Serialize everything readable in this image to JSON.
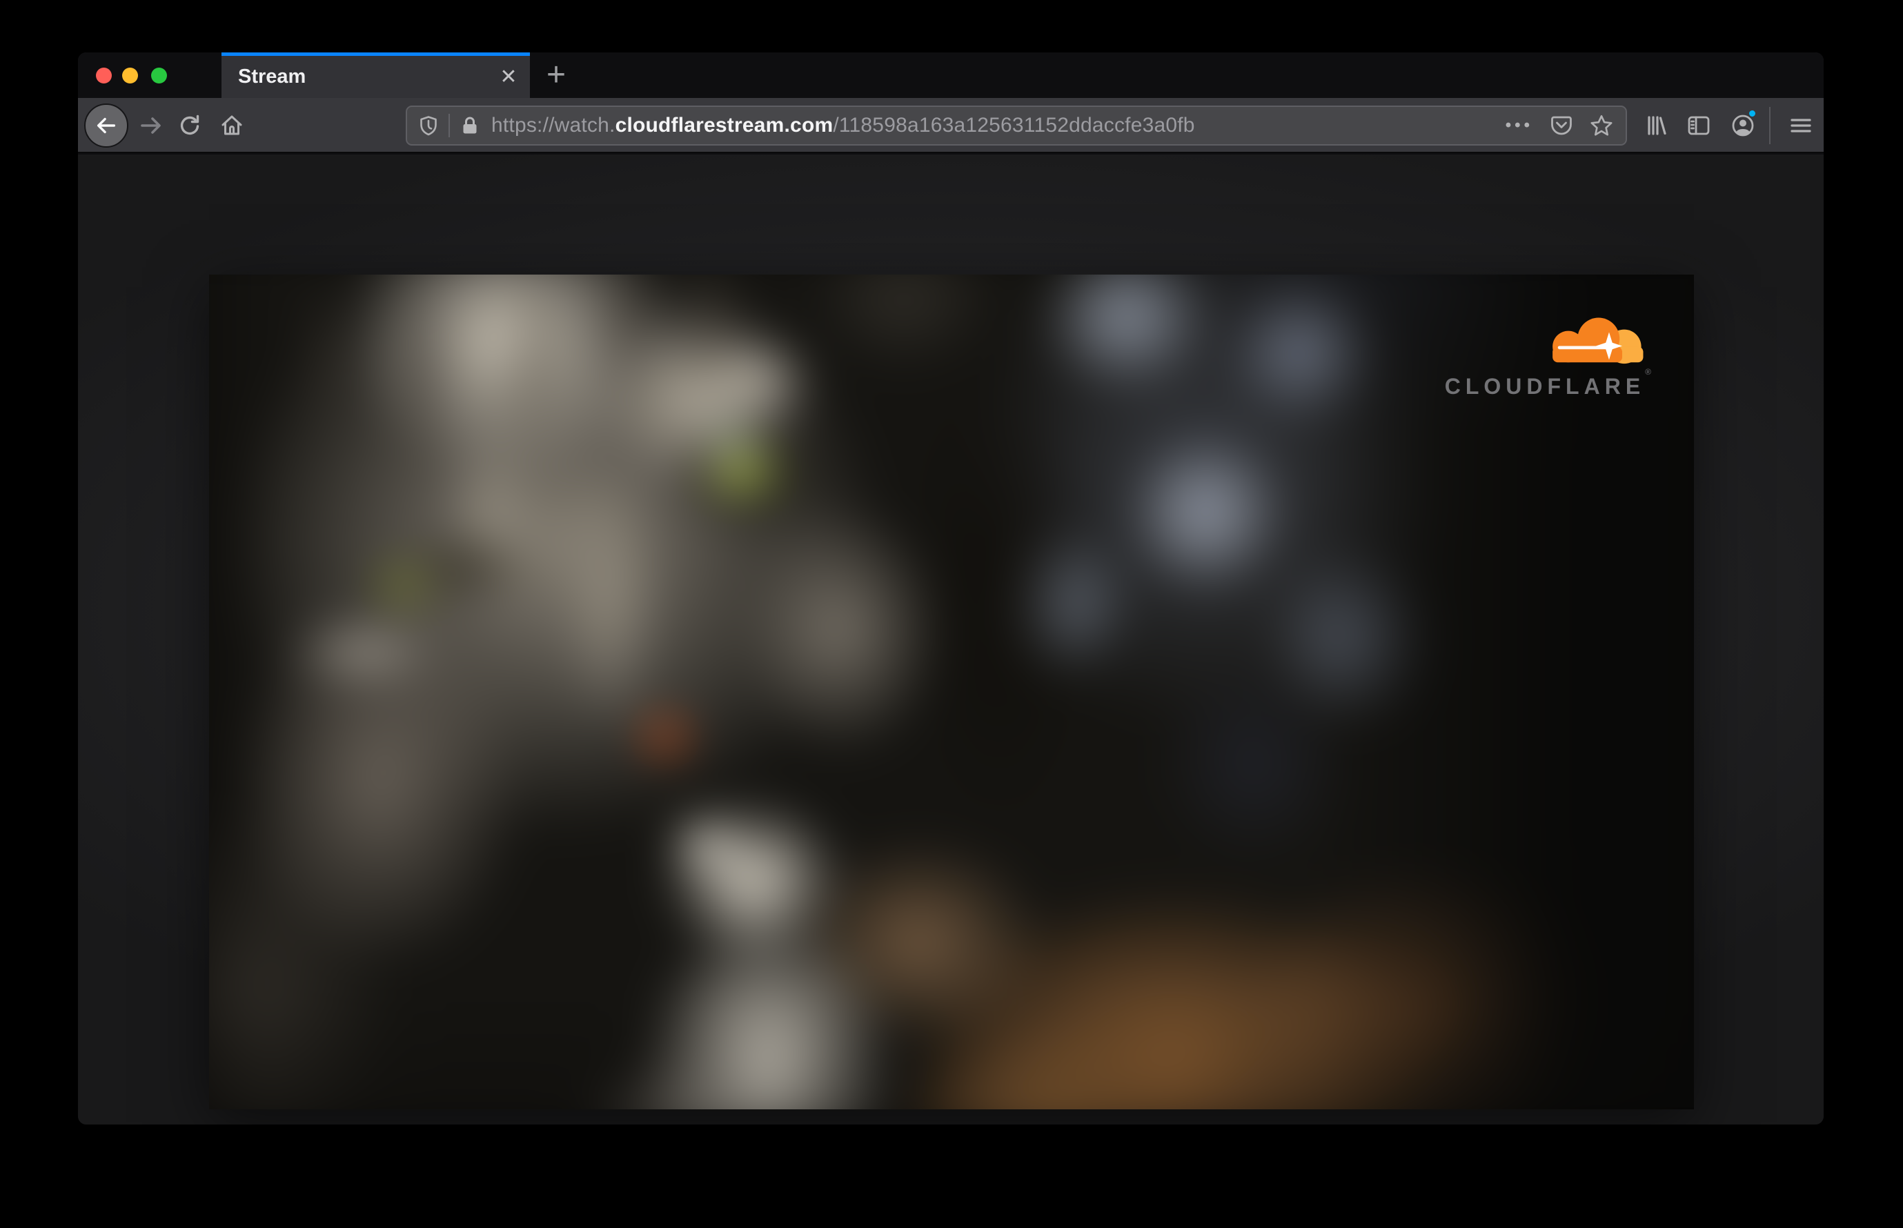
{
  "window": {
    "traffic_lights": {
      "close": "close",
      "minimize": "minimize",
      "zoom": "zoom"
    }
  },
  "tabbar": {
    "tab_title": "Stream",
    "close_glyph": "✕",
    "new_tab_glyph": "+"
  },
  "toolbar": {
    "url": {
      "prefix": "https://watch.",
      "host": "cloudflarestream.com",
      "path": "/118598a163a125631152ddaccfe3a0fb"
    },
    "page_actions_glyph": "•••"
  },
  "video": {
    "watermark": "CLOUDFLARE",
    "watermark_mark": "®"
  },
  "colors": {
    "tab_accent_blue": "#0a84ff",
    "cloud_orange": "#f6821f",
    "cloud_light_orange": "#fbad41",
    "traffic_red": "#ff5f58",
    "traffic_yellow": "#ffbd2e",
    "traffic_green": "#28c840",
    "notification_dot_blue": "#00b3f4"
  }
}
